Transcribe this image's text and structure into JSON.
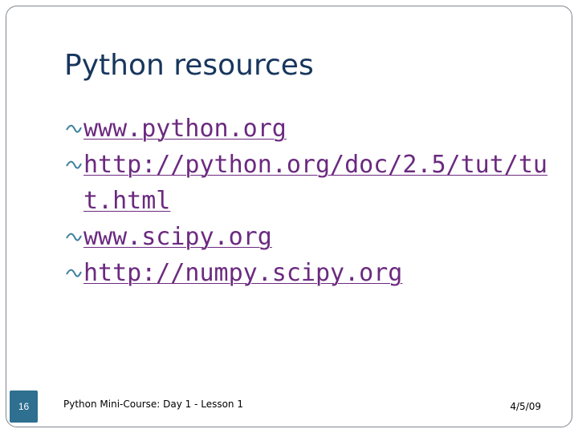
{
  "slide": {
    "title": "Python resources",
    "bullets": [
      {
        "text": "www.python.org",
        "icon": "bullet-wave-icon"
      },
      {
        "text": "http://python.org/doc/2.5/tut/tut.html",
        "icon": "bullet-wave-icon"
      },
      {
        "text": "www.scipy.org",
        "icon": "bullet-wave-icon"
      },
      {
        "text": "http://numpy.scipy.org",
        "icon": "bullet-wave-icon"
      }
    ],
    "link_color": "#6b2a7f",
    "title_color": "#17365d"
  },
  "footer": {
    "slide_number": "16",
    "text": "Python Mini-Course: Day 1 - Lesson 1",
    "date": "4/5/09",
    "badge_color": "#2f6f8f"
  }
}
